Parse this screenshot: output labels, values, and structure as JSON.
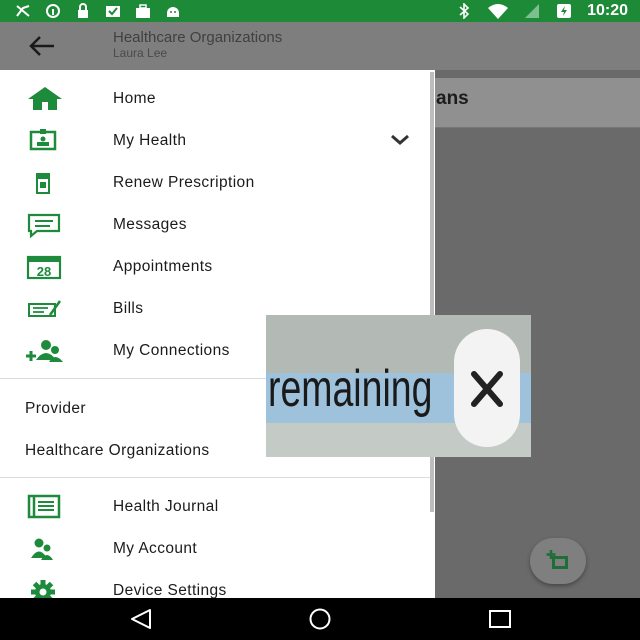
{
  "status_bar": {
    "time": "10:20",
    "left_icons": [
      "sync-off-icon",
      "info-icon",
      "lock-icon",
      "inbox-icon",
      "briefcase-icon",
      "android-icon"
    ],
    "right_icons": [
      "bluetooth-icon",
      "wifi-icon",
      "signal-icon",
      "battery-charging-icon"
    ],
    "color": "#1d8a37"
  },
  "app_bar": {
    "title": "Healthcare Organizations",
    "subtitle": "Laura Lee"
  },
  "background": {
    "heading_fragment": "ans"
  },
  "drawer": {
    "accent_color": "#1e8a3c",
    "section1": [
      {
        "label": "Home",
        "icon": "home-icon"
      },
      {
        "label": "My Health",
        "icon": "id-card-icon"
      },
      {
        "label": "Renew Prescription",
        "icon": "prescription-icon"
      },
      {
        "label": "Messages",
        "icon": "message-icon"
      },
      {
        "label": "Appointments",
        "icon": "calendar-icon",
        "icon_text": "28"
      },
      {
        "label": "Bills",
        "icon": "bill-icon"
      },
      {
        "label": "My Connections",
        "icon": "connections-icon"
      }
    ],
    "section2": [
      {
        "label": "Provider"
      },
      {
        "label": "Healthcare Organizations"
      }
    ],
    "section3": [
      {
        "label": "Health Journal",
        "icon": "journal-icon"
      },
      {
        "label": "My Account",
        "icon": "account-icon"
      },
      {
        "label": "Device Settings",
        "icon": "gear-icon"
      }
    ]
  },
  "overlay": {
    "text": "remaining"
  }
}
